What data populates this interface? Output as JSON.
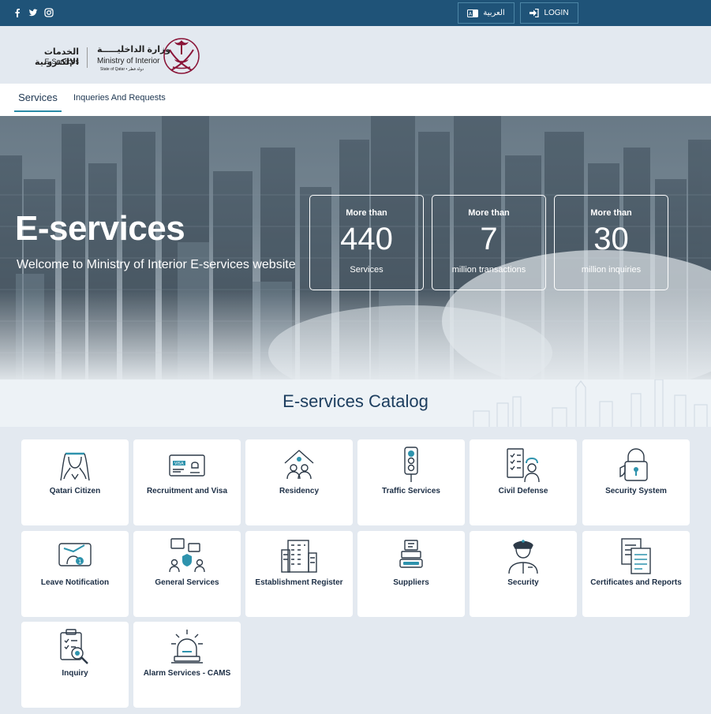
{
  "topbar": {
    "social": [
      "facebook-icon",
      "twitter-icon",
      "instagram-icon"
    ],
    "arabic_label": "العربية",
    "login_label": "LOGIN"
  },
  "header": {
    "eservices_ar": "الخدمات الإلكترونية",
    "eservices_en": "E-Services",
    "moi_ar": "وزارة الداخليـــــة",
    "moi_en": "Ministry of Interior",
    "state": "State of Qatar • دولة قطر"
  },
  "nav": {
    "tabs": [
      "Services",
      "Inqueries And Requests"
    ]
  },
  "hero": {
    "title": "E-services",
    "subtitle": "Welcome to Ministry of Interior E-services website",
    "stats": [
      {
        "pre": "More than",
        "value": "440",
        "label": "Services"
      },
      {
        "pre": "More than",
        "value": "7",
        "label": "million transactions"
      },
      {
        "pre": "More than",
        "value": "30",
        "label": "million inquiries"
      }
    ]
  },
  "catalog": {
    "title": "E-services Catalog",
    "items": [
      {
        "label": "Qatari Citizen",
        "icon": "citizen-icon"
      },
      {
        "label": "Recruitment and Visa",
        "icon": "visa-icon"
      },
      {
        "label": "Residency",
        "icon": "residency-icon"
      },
      {
        "label": "Traffic Services",
        "icon": "traffic-light-icon"
      },
      {
        "label": "Civil Defense",
        "icon": "civil-defense-icon"
      },
      {
        "label": "Security System",
        "icon": "padlock-icon"
      },
      {
        "label": "Leave Notification",
        "icon": "leave-notification-icon"
      },
      {
        "label": "General Services",
        "icon": "general-services-icon"
      },
      {
        "label": "Establishment Register",
        "icon": "building-icon"
      },
      {
        "label": "Suppliers",
        "icon": "suppliers-icon"
      },
      {
        "label": "Security",
        "icon": "police-officer-icon"
      },
      {
        "label": "Certificates and Reports",
        "icon": "documents-icon"
      },
      {
        "label": "Inquiry",
        "icon": "inquiry-clipboard-icon"
      },
      {
        "label": "Alarm Services - CAMS",
        "icon": "alarm-icon"
      }
    ]
  },
  "colors": {
    "topbar": "#1f5378",
    "accent": "#2a8aa6",
    "icon_stroke": "#2d3a48",
    "icon_accent": "#2e93ad"
  }
}
